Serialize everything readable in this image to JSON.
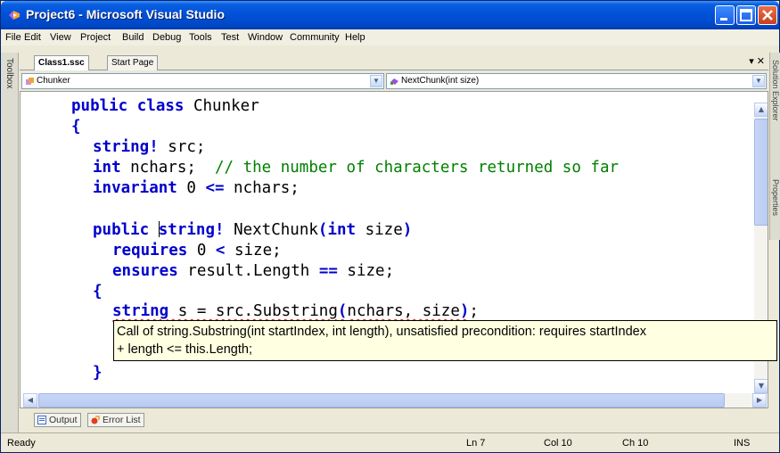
{
  "window": {
    "title": "Project6 - Microsoft Visual Studio"
  },
  "menu": [
    "File",
    "Edit",
    "View",
    "Project",
    "Build",
    "Debug",
    "Tools",
    "Test",
    "Window",
    "Community",
    "Help"
  ],
  "toolbox_label": "Toolbox",
  "right_panels": [
    "Solution Explorer",
    "Properties"
  ],
  "doc_tabs": [
    {
      "label": "Class1.ssc",
      "active": true
    },
    {
      "label": "Start Page",
      "active": false
    }
  ],
  "tab_controls": "▾ ✕",
  "nav": {
    "type_combo": "Chunker",
    "member_combo": "NextChunk(int size)"
  },
  "code": {
    "l1_kw": "public class",
    "l1_name": " Chunker",
    "l2": "{",
    "l3_kw": "string!",
    "l3_rest": " src;",
    "l4_kw": "int",
    "l4_rest": " nchars;  ",
    "l4_comment": "// the number of characters returned so far",
    "l5_kw": "invariant",
    "l5_rest": " 0 ",
    "l5_op": "<=",
    "l5_end": " nchars;",
    "l7_kw1": "public",
    "l7_sp": " ",
    "l7_kw2": "string!",
    "l7_name": " NextChunk",
    "l7_paren_open": "(",
    "l7_kw3": "int",
    "l7_param": " size",
    "l7_paren_close": ")",
    "l8_kw": "requires",
    "l8_rest": " 0 ",
    "l8_op": "<",
    "l8_end": " size;",
    "l9_kw": "ensures",
    "l9_rest": " result.Length ",
    "l9_op": "==",
    "l9_end": " size;",
    "l10": "{",
    "l11_kw": "string",
    "l11_rest": " s = src.Substring",
    "l11_paren": "(",
    "l11_args": "nchars, size",
    "l11_close": ")",
    "l11_semi": ";",
    "l13": "}"
  },
  "tooltip": {
    "line1": "Call of string.Substring(int startIndex, int length), unsatisfied precondition: requires startIndex",
    "line2": "+ length <= this.Length;"
  },
  "tool_tabs": [
    "Output",
    "Error List"
  ],
  "status": {
    "text": "Ready",
    "ln": "Ln 7",
    "col": "Col 10",
    "ch": "Ch 10",
    "mode": "INS"
  },
  "colors": {
    "keyword": "#0000cc",
    "comment": "#008000",
    "titlebar": "#0050d8",
    "tooltip_bg": "#ffffe1"
  }
}
